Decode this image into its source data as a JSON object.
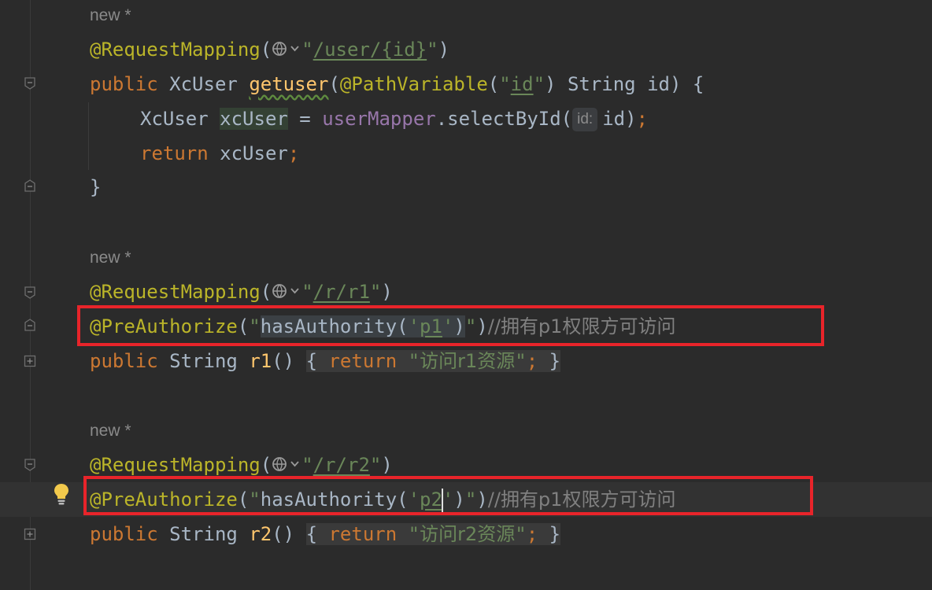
{
  "methods": [
    {
      "usage_hint": "new *",
      "mapping_annotation": "@RequestMapping",
      "mapping_path": "/user/{id}",
      "sig_public": "public ",
      "sig_type": "XcUser ",
      "sig_name": "getuser",
      "param_annotation": "@PathVariable",
      "param_value": "id",
      "param_type": "String id",
      "body_line1_type": "XcUser ",
      "body_line1_var": "xcUser",
      "body_line1_eq": " = ",
      "body_line1_field": "userMapper",
      "body_line1_call": ".selectById(",
      "body_line1_hint": "id:",
      "body_line1_arg": "id)",
      "body_line2_kw": "return ",
      "body_line2_var": "xcUser",
      "close_brace": "}"
    },
    {
      "usage_hint": "new *",
      "mapping_annotation": "@RequestMapping",
      "mapping_path": "/r/r1",
      "auth_annotation": "@PreAuthorize",
      "auth_expr_prefix": "hasAuthority(",
      "auth_perm": "p1",
      "auth_expr_suffix": ")",
      "auth_comment": "//拥有p1权限方可访问",
      "sig_public": "public ",
      "sig_type": "String ",
      "sig_name": "r1",
      "return_kw": "return ",
      "return_value": "访问r1资源"
    },
    {
      "usage_hint": "new *",
      "mapping_annotation": "@RequestMapping",
      "mapping_path": "/r/r2",
      "auth_annotation": "@PreAuthorize",
      "auth_expr_prefix": "hasAuthority(",
      "auth_perm": "p2",
      "auth_expr_suffix": ")",
      "auth_comment": "//拥有p1权限方可访问",
      "sig_public": "public ",
      "sig_type": "String ",
      "sig_name": "r2",
      "return_kw": "return ",
      "return_value": "访问r2资源"
    }
  ],
  "colors": {
    "background": "#2b2b2b",
    "annotation": "#bbb529",
    "keyword": "#cc7832",
    "string": "#6a8759",
    "method": "#ffc66d",
    "field": "#9876aa",
    "comment": "#808080",
    "highlight_box": "#e8242a"
  },
  "icons": [
    "fold-icon",
    "unfold-icon",
    "lightbulb-icon",
    "globe-icon"
  ]
}
